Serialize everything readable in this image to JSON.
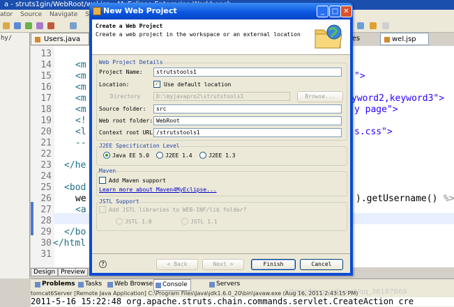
{
  "ide": {
    "title": "a - struts1gin/WebRoot/wel.jsp - MyEclipse Enterprise Workbench",
    "menu": [
      "ator",
      "Source",
      "Navigate",
      "Sear"
    ],
    "left_strip_label": "hy/",
    "editor_tabs": {
      "users": "Users.java",
      "ties": "ties",
      "wel": "wel.jsp"
    },
    "line_numbers": [
      "13",
      "14",
      "15",
      "16",
      "17",
      "18",
      "19",
      "20",
      "21",
      "22",
      "23",
      "24",
      "25",
      "26",
      "27",
      "28",
      "29",
      "30",
      "31"
    ],
    "code_lines": {
      "l14": "<m",
      "l15": "<m",
      "l16": "<m",
      "l17": "<m",
      "l18": "<m",
      "l19": "<!",
      "l20": "<l",
      "l21": "--",
      "l23": "</he",
      "l25": "<bod",
      "l26": "we",
      "l27": "<a",
      "l29": "</bo",
      "l30": "</html",
      "r15": "\">",
      "r17": "yword2,keyword3\">",
      "r18": "y page\">",
      "r20": "s.css\">",
      "r26a": ").getUsername()",
      "r26b": "%>"
    },
    "design_tabs": [
      "Design",
      "Preview"
    ],
    "bottom_tabs": [
      "Problems",
      "Tasks",
      "Web Browser",
      "Console",
      "Servers"
    ],
    "console_header": "tomcat6Server [Remote Java Application] C:\\Program Files\\Java\\jdk1.6.0_20\\bin\\javaw.exe (Aug 16, 2011 2:43:15 PM)",
    "console_line": "2011-5-16 15:22:48 org.apache.struts.chain.commands.servlet.CreateAction cre",
    "watermark": "https://blog.csdn.net/qq_36187869"
  },
  "dialog": {
    "title": "New Web Project",
    "window_buttons": {
      "minimize": "_",
      "maximize": "□",
      "close": "✕"
    },
    "header_title": "Create a Web Project",
    "header_desc": "Create a web project in the workspace or an external location",
    "details": {
      "group_title": "Web Project Details",
      "project_name_label": "Project Name:",
      "project_name_value": "strutstools1",
      "location_label": "Location:",
      "use_default_label": "Use default location",
      "use_default_checked": true,
      "directory_label": "Directory",
      "directory_value": "D:\\myjavapro2\\strutstools1",
      "browse_label": "Browse...",
      "source_folder_label": "Source folder:",
      "source_folder_value": "src",
      "web_root_label": "Web root folder:",
      "web_root_value": "WebRoot",
      "context_root_label": "Context root URL:",
      "context_root_value": "/strutstools1"
    },
    "j2ee": {
      "group_title": "J2EE Specification Level",
      "options": [
        "Java EE 5.0",
        "J2EE 1.4",
        "J2EE 1.3"
      ],
      "selected": "Java EE 5.0"
    },
    "maven": {
      "group_title": "Maven",
      "add_support_label": "Add Maven support",
      "add_support_checked": false,
      "learn_more_link": "Learn more about Maven4MyEclipse..."
    },
    "jstl": {
      "group_title": "JSTL Support",
      "add_libs_label": "Add JSTL libraries to WEB-INF/lib folder?",
      "options": [
        "JSTL 1.0",
        "JSTL 1.1"
      ]
    },
    "buttons": {
      "help": "?",
      "back": "< Back",
      "next": "Next >",
      "finish": "Finish",
      "cancel": "Cancel"
    }
  },
  "colors": {
    "titlebar": "#0a55e0",
    "dialog_bg": "#ece9d8",
    "group_title": "#1f45a8",
    "check_mark": "#21a121"
  }
}
